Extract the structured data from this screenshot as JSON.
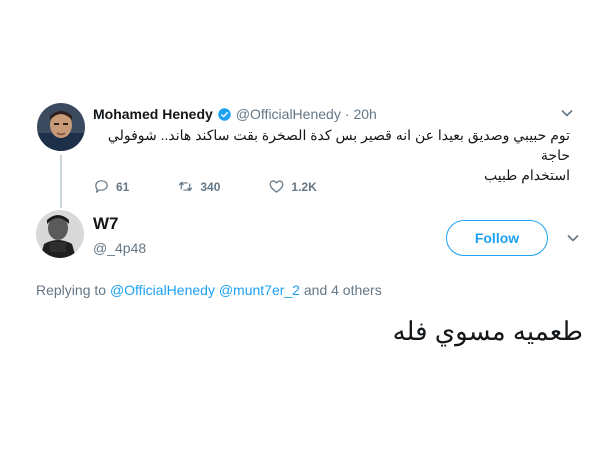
{
  "original_tweet": {
    "display_name": "Mohamed Henedy",
    "handle": "@OfficialHenedy",
    "separator": "·",
    "time": "20h",
    "text_line1": "توم حبيبي وصديق بعيدا عن انه قصير بس كدة الصخرة بقت ساكند هاند.. شوفولي حاجة",
    "text_line2": "استخدام طبيب",
    "reply_count": "61",
    "retweet_count": "340",
    "like_count": "1.2K",
    "icons": [
      "verified-badge-icon",
      "chevron-down-icon",
      "reply-icon",
      "retweet-icon",
      "like-icon"
    ]
  },
  "reply_tweet": {
    "display_name": "W7",
    "handle": "@_4p48",
    "follow_label": "Follow",
    "replying_prefix": "Replying to",
    "replying_user1": "@OfficialHenedy",
    "replying_user2": "@munt7er_2",
    "replying_suffix": "and 4 others",
    "text": "طعميه مسوي فله",
    "icons": [
      "chevron-down-icon"
    ]
  },
  "colors": {
    "accent": "#1da1f2",
    "muted": "#657786",
    "text": "#14171a",
    "thread_line": "#ccd6dd"
  }
}
